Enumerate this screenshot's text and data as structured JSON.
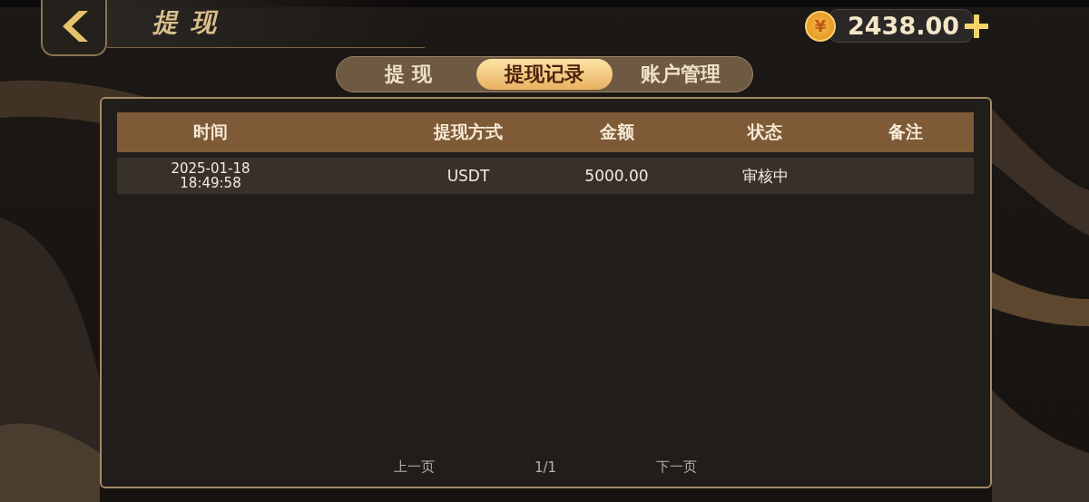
{
  "header": {
    "title": "提 现",
    "coin_symbol": "¥",
    "balance": "2438.00"
  },
  "tabs": [
    {
      "label": "提 现",
      "selected": false
    },
    {
      "label": "提现记录",
      "selected": true
    },
    {
      "label": "账户管理",
      "selected": false
    }
  ],
  "table": {
    "columns": [
      "时间",
      "提现方式",
      "金额",
      "状态",
      "备注"
    ],
    "rows": [
      {
        "cells": [
          "2025-01-18 18:49:58",
          "USDT",
          "5000.00",
          "审核中"
        ]
      }
    ]
  },
  "pager": {
    "previous": "上一页",
    "page": "1/1",
    "next": "下一页"
  }
}
